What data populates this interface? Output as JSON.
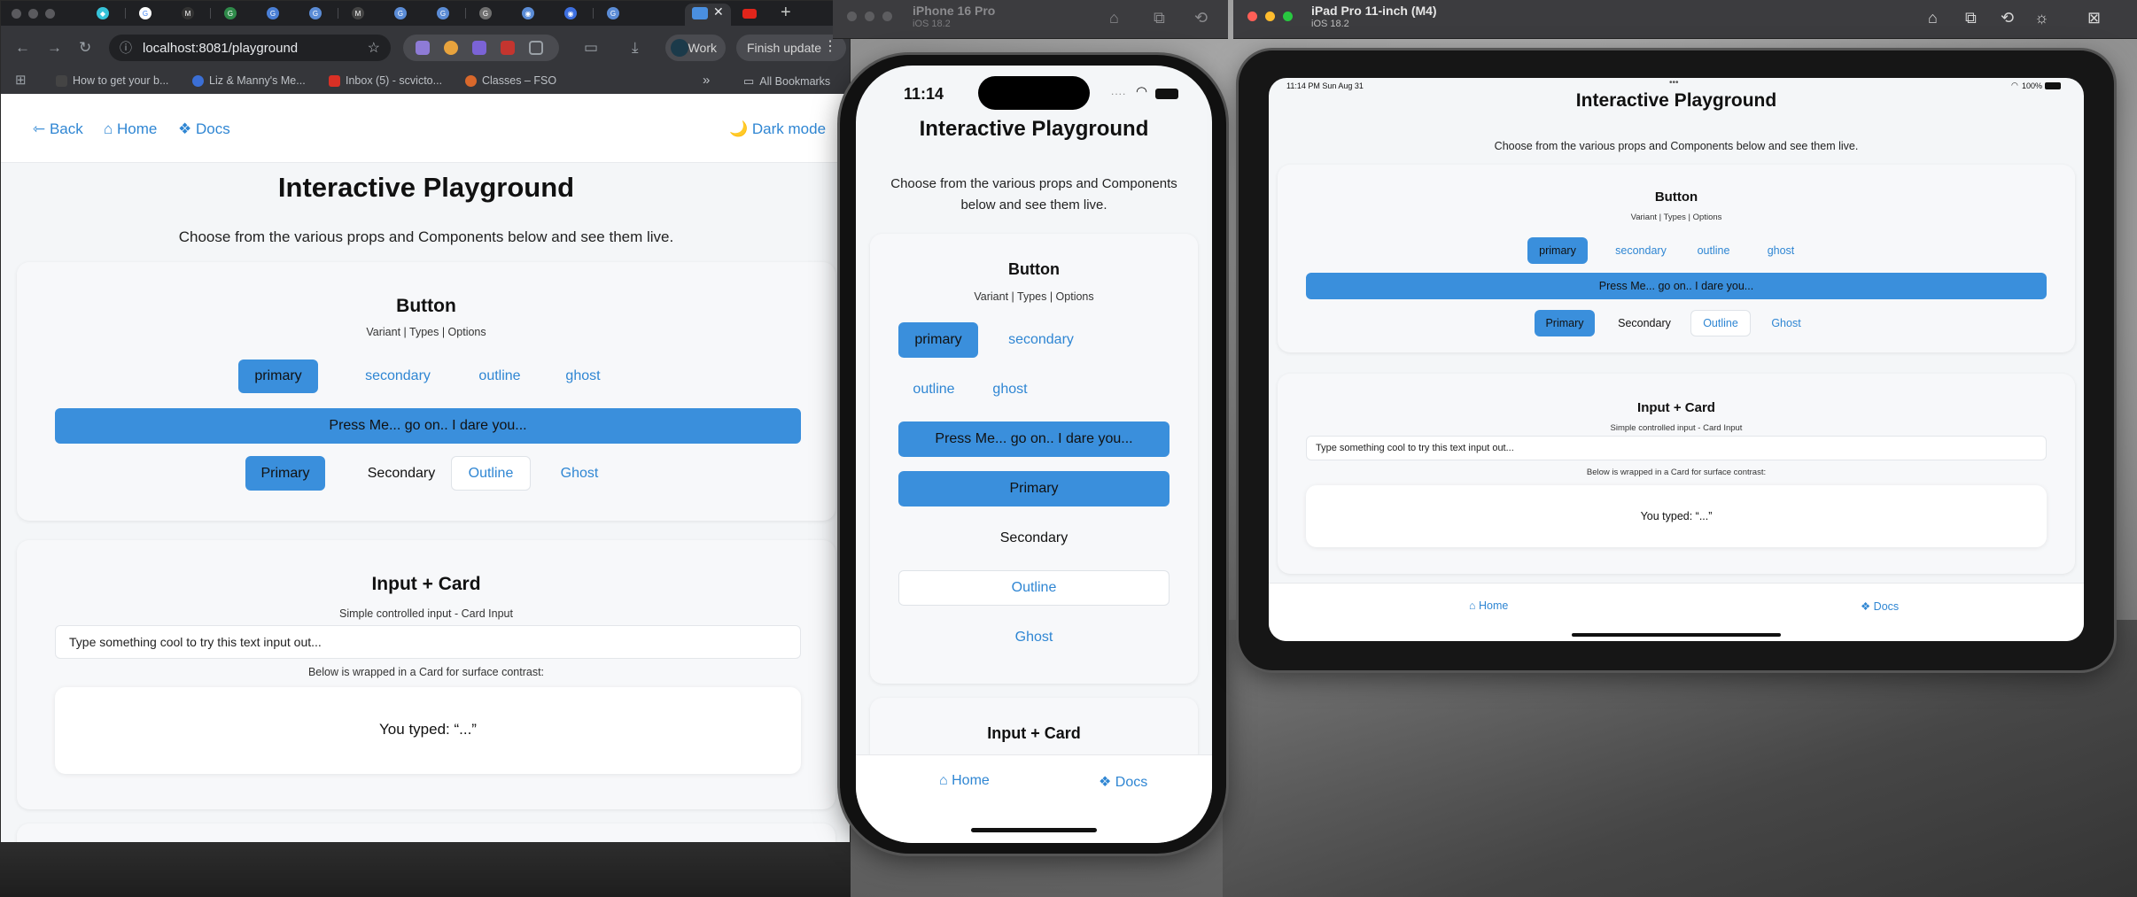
{
  "chrome": {
    "url": "localhost:8081/playground",
    "tab_icons": [
      "◆",
      "G",
      "M",
      "G",
      "G",
      "G",
      "M",
      "G",
      "G",
      "G",
      "◉",
      "◉",
      "G"
    ],
    "extensions_work_label": "Work",
    "finish_update_label": "Finish update",
    "bookmarks": [
      {
        "label": "How to get your b...",
        "color": "#444"
      },
      {
        "label": "Liz & Manny's Me...",
        "color": "#3b6fd6"
      },
      {
        "label": "Inbox (5) - scvicto...",
        "color": "#d93025"
      },
      {
        "label": "Classes – FSO",
        "color": "#d9682b"
      }
    ],
    "all_bookmarks": "All Bookmarks"
  },
  "app": {
    "nav": {
      "back": "⇽ Back",
      "home": "⌂ Home",
      "docs": "❖ Docs",
      "dark_mode": "🌙 Dark mode"
    },
    "title": "Interactive Playground",
    "subtitle": "Choose from the various props and Components below and see them live.",
    "button_card": {
      "title": "Button",
      "subtitle": "Variant | Types | Options",
      "variants": [
        "primary",
        "secondary",
        "outline",
        "ghost"
      ],
      "cta": "Press Me... go on.. I dare you...",
      "samples": [
        "Primary",
        "Secondary",
        "Outline",
        "Ghost"
      ]
    },
    "input_card": {
      "title": "Input + Card",
      "subtitle": "Simple controlled input - Card Input",
      "placeholder": "Type something cool to try this text input out...",
      "wrap_note": "Below is wrapped in a Card for surface contrast:",
      "typed": "You typed: “...”"
    },
    "tabbar": {
      "home": "⌂ Home",
      "docs": "❖ Docs"
    }
  },
  "iphone": {
    "sim_name": "iPhone 16 Pro",
    "sim_os": "iOS 18.2",
    "time": "11:14"
  },
  "ipad": {
    "sim_name": "iPad Pro 11-inch (M4)",
    "sim_os": "iOS 18.2",
    "status_time": "11:14 PM   Sun Aug 31",
    "battery": "100%"
  },
  "colors": {
    "accent": "#3a8fdc",
    "link": "#2f86d3"
  }
}
